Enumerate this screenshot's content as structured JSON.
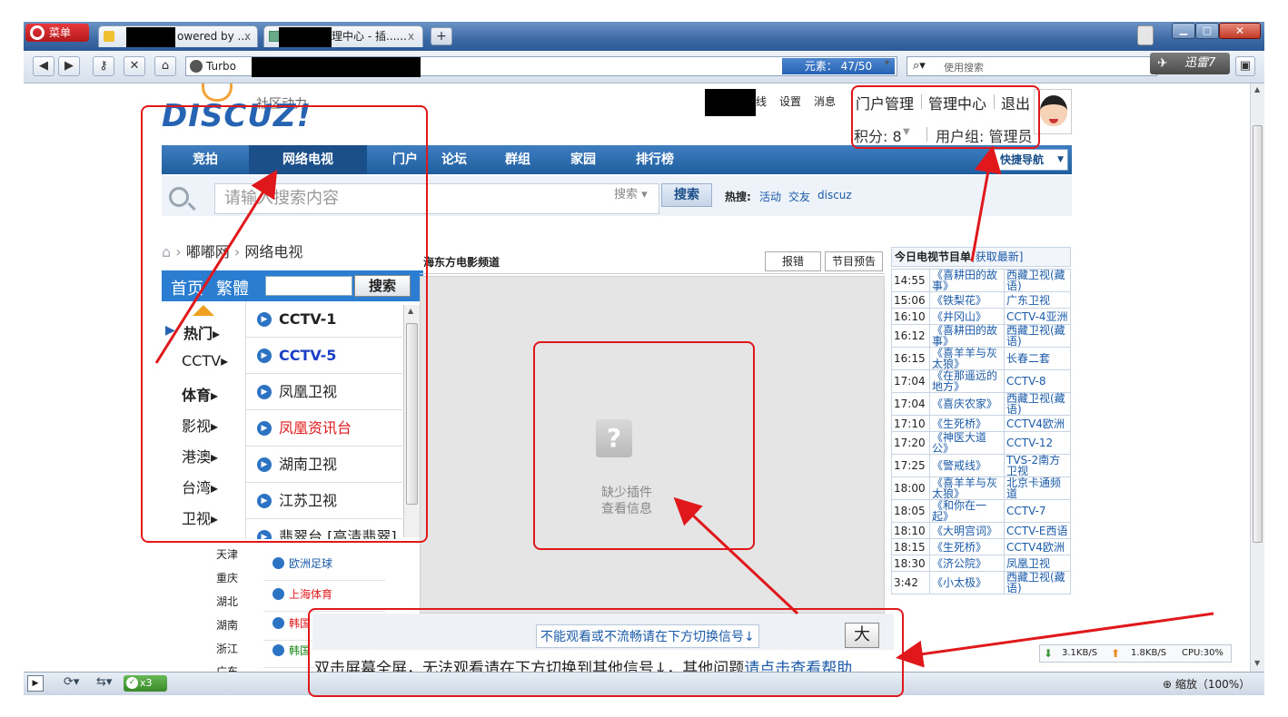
{
  "browser": {
    "menu_label": "菜单",
    "tabs": [
      {
        "label": "owered by ...",
        "close": "x"
      },
      {
        "label": "理中心 - 插......",
        "close": "x"
      }
    ],
    "new_tab": "+",
    "turbo_label": "Turbo",
    "search_counter": "元素： 47/50",
    "search_placeholder": "使用搜索",
    "xunlei_label": "迅雷7",
    "status_tab_count": "x3",
    "download_speed": "3.1KB/S",
    "upload_speed": "1.8KB/S",
    "cpu": "CPU:30%",
    "zoom": "缩放（100%）"
  },
  "site": {
    "logo_top": "社区动力",
    "logo": "DISCUZ!",
    "user_links": [
      "线",
      "设置",
      "消息"
    ],
    "admin_links": [
      "门户管理",
      "管理中心",
      "退出"
    ],
    "points_label": "积分: 8",
    "usergroup_label": "用户组: 管理员",
    "nav": [
      "竞拍",
      "网络电视",
      "门户",
      "论坛",
      "群组",
      "家园",
      "排行榜"
    ],
    "quick_nav": "快捷导航",
    "search_placeholder": "请输入搜索内容",
    "search_type": "搜索",
    "search_button": "搜索",
    "hot_label": "热搜:",
    "hot_terms": [
      "活动",
      "交友",
      "discuz"
    ],
    "breadcrumb": [
      "嘟嘟网",
      "网络电视"
    ]
  },
  "tv": {
    "home_link": "首页",
    "traditional_link": "繁體",
    "search_button": "搜索",
    "categories": [
      {
        "label": "热门",
        "color": "#e8700c"
      },
      {
        "label": "CCTV",
        "color": "#222222"
      },
      {
        "label": "体育",
        "color": "#222222"
      },
      {
        "label": "影视",
        "color": "#e0181b"
      },
      {
        "label": "港澳",
        "color": "#222222"
      },
      {
        "label": "台湾",
        "color": "#222222"
      },
      {
        "label": "卫视",
        "color": "#222222"
      }
    ],
    "channels": [
      {
        "label": "CCTV-1",
        "color": "#222222"
      },
      {
        "label": "CCTV-5",
        "color": "#1a3fc4"
      },
      {
        "label": "凤凰卫视",
        "color": "#222222"
      },
      {
        "label": "凤凰资讯台",
        "color": "#e0181b"
      },
      {
        "label": "湖南卫视",
        "color": "#222222"
      },
      {
        "label": "江苏卫视",
        "color": "#222222"
      },
      {
        "label": "翡翠台 [高清翡翠]",
        "color": "#222222"
      }
    ],
    "provinces": [
      "天津",
      "重庆",
      "湖北",
      "湖南",
      "浙江",
      "广东"
    ],
    "small_channels": [
      {
        "label": "欧洲足球",
        "color": "#1a3fc4"
      },
      {
        "label": "上海体育",
        "color": "#e0181b"
      },
      {
        "label": "韩国",
        "color": "#e0181b"
      },
      {
        "label": "韩国",
        "color": "#1a8a1a"
      }
    ],
    "player_title": "海东方电影频道",
    "report_button": "报错",
    "preview_button": "节目预告",
    "plugin_missing_line1": "缺少插件",
    "plugin_missing_line2": "查看信息",
    "switch_signal_tip": "不能观看或不流畅请在下方切换信号↓",
    "big_button": "大",
    "help_text": "双击屏幕全屏，无法观看请在下方切换到其他信号↓，其他问题",
    "help_link": "请点击查看帮助"
  },
  "epg": {
    "title": "今日电视节目单",
    "refresh": "[获取最新]",
    "rows": [
      {
        "time": "14:55",
        "program": "《喜耕田的故事》",
        "channel": "西藏卫视(藏语)"
      },
      {
        "time": "15:06",
        "program": "《铁梨花》",
        "channel": "广东卫视"
      },
      {
        "time": "16:10",
        "program": "《井冈山》",
        "channel": "CCTV-4亚洲"
      },
      {
        "time": "16:12",
        "program": "《喜耕田的故事》",
        "channel": "西藏卫视(藏语)"
      },
      {
        "time": "16:15",
        "program": "《喜羊羊与灰太狼》",
        "channel": "长春二套"
      },
      {
        "time": "17:04",
        "program": "《在那遥远的地方》",
        "channel": "CCTV-8"
      },
      {
        "time": "17:04",
        "program": "《喜庆农家》",
        "channel": "西藏卫视(藏语)"
      },
      {
        "time": "17:10",
        "program": "《生死桥》",
        "channel": "CCTV4欧洲"
      },
      {
        "time": "17:20",
        "program": "《神医大道公》",
        "channel": "CCTV-12"
      },
      {
        "time": "17:25",
        "program": "《警戒线》",
        "channel": "TVS-2南方卫视"
      },
      {
        "time": "18:00",
        "program": "《喜羊羊与灰太狼》",
        "channel": "北京卡通频道"
      },
      {
        "time": "18:05",
        "program": "《和你在一起》",
        "channel": "CCTV-7"
      },
      {
        "time": "18:10",
        "program": "《大明宫词》",
        "channel": "CCTV-E西语"
      },
      {
        "time": "18:15",
        "program": "《生死桥》",
        "channel": "CCTV4欧洲"
      },
      {
        "time": "18:30",
        "program": "《济公院》",
        "channel": "凤凰卫视"
      },
      {
        "time": "3:42",
        "program": "《小太极》",
        "channel": "西藏卫视(藏语)"
      }
    ]
  }
}
